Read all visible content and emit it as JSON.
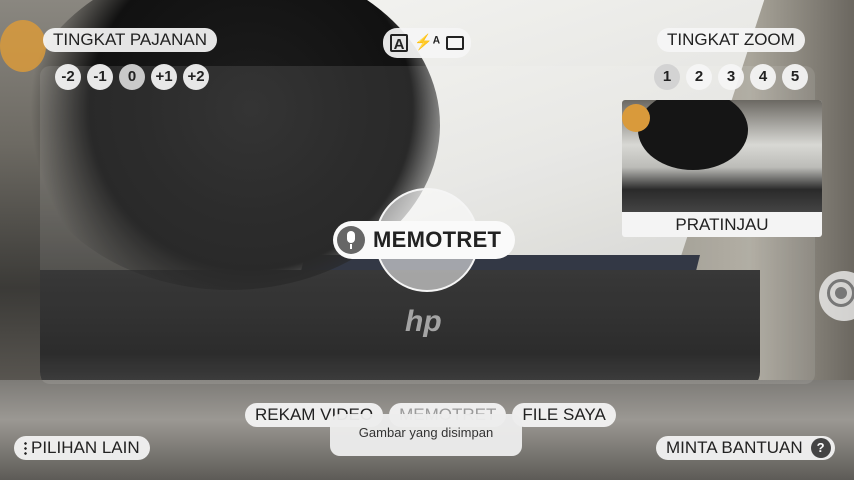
{
  "exposure": {
    "title": "TINGKAT PAJANAN",
    "levels": [
      "-2",
      "-1",
      "0",
      "+1",
      "+2"
    ],
    "selected": "0"
  },
  "zoom": {
    "title": "TINGKAT ZOOM",
    "levels": [
      "1",
      "2",
      "3",
      "4",
      "5"
    ],
    "selected": "1"
  },
  "mode_toggles": {
    "icons": [
      "auto-text-icon",
      "auto-flash-icon",
      "aspect-ratio-icon"
    ],
    "auto_text_glyph": "A",
    "flash_glyph": "⚡ᴬ"
  },
  "preview": {
    "label": "PRATINJAU"
  },
  "shutter": {
    "label": "MEMOTRET",
    "icon": "microphone-icon"
  },
  "bottom_tabs": {
    "record_video": "REKAM VIDEO",
    "take_photo": "MEMOTRET",
    "my_files": "FILE SAYA",
    "active": "take_photo"
  },
  "toast": {
    "text": "Gambar yang disimpan"
  },
  "more_options": {
    "label": "PILIHAN LAIN",
    "icon": "more-vertical-icon"
  },
  "help": {
    "label": "MINTA BANTUAN",
    "icon_glyph": "?"
  },
  "target_button": {
    "icon": "crosshair-icon"
  }
}
